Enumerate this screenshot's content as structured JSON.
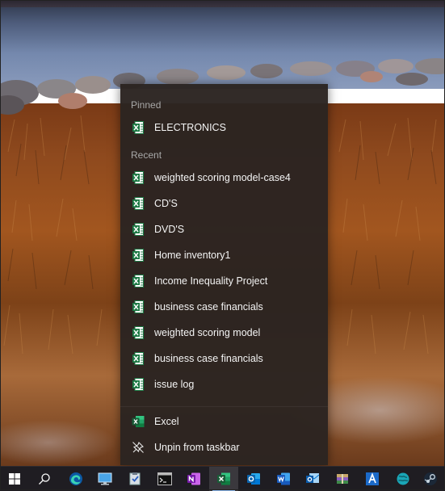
{
  "jumplist": {
    "pinned_label": "Pinned",
    "pinned": [
      {
        "label": "ELECTRONICS",
        "icon": "excel-file-icon"
      }
    ],
    "recent_label": "Recent",
    "recent": [
      {
        "label": "weighted scoring model-case4",
        "icon": "excel-file-icon"
      },
      {
        "label": "CD'S",
        "icon": "excel-file-icon"
      },
      {
        "label": "DVD'S",
        "icon": "excel-file-icon"
      },
      {
        "label": "Home inventory1",
        "icon": "excel-file-icon"
      },
      {
        "label": "Income Inequality Project",
        "icon": "excel-file-icon"
      },
      {
        "label": "business case financials",
        "icon": "excel-file-icon"
      },
      {
        "label": "weighted scoring model",
        "icon": "excel-file-icon"
      },
      {
        "label": "business case financials",
        "icon": "excel-file-icon"
      },
      {
        "label": "issue log",
        "icon": "excel-file-icon"
      }
    ],
    "tasks": [
      {
        "label": "Excel",
        "icon": "excel-app-icon"
      },
      {
        "label": "Unpin from taskbar",
        "icon": "unpin-icon"
      }
    ]
  },
  "taskbar": {
    "buttons": [
      {
        "name": "start-button",
        "icon": "windows-logo-icon"
      },
      {
        "name": "search-button",
        "icon": "search-icon"
      },
      {
        "name": "edge-button",
        "icon": "edge-icon"
      },
      {
        "name": "remote-desktop-button",
        "icon": "remote-desktop-icon"
      },
      {
        "name": "task-app-button",
        "icon": "clipboard-check-icon"
      },
      {
        "name": "command-prompt-button",
        "icon": "command-prompt-icon"
      },
      {
        "name": "onenote-button",
        "icon": "onenote-icon"
      },
      {
        "name": "excel-button",
        "icon": "excel-icon",
        "active": true
      },
      {
        "name": "outlook-button",
        "icon": "outlook-icon"
      },
      {
        "name": "word-button",
        "icon": "word-icon"
      },
      {
        "name": "outlook-alt-button",
        "icon": "outlook-alt-icon"
      },
      {
        "name": "winrar-button",
        "icon": "archive-icon"
      },
      {
        "name": "font-app-button",
        "icon": "font-icon"
      },
      {
        "name": "globe-app-button",
        "icon": "globe-icon"
      },
      {
        "name": "steam-button",
        "icon": "steam-icon"
      }
    ]
  },
  "colors": {
    "excel_green": "#1d7a45",
    "menu_bg": "#2b2421",
    "taskbar_bg": "#1f1d22"
  }
}
